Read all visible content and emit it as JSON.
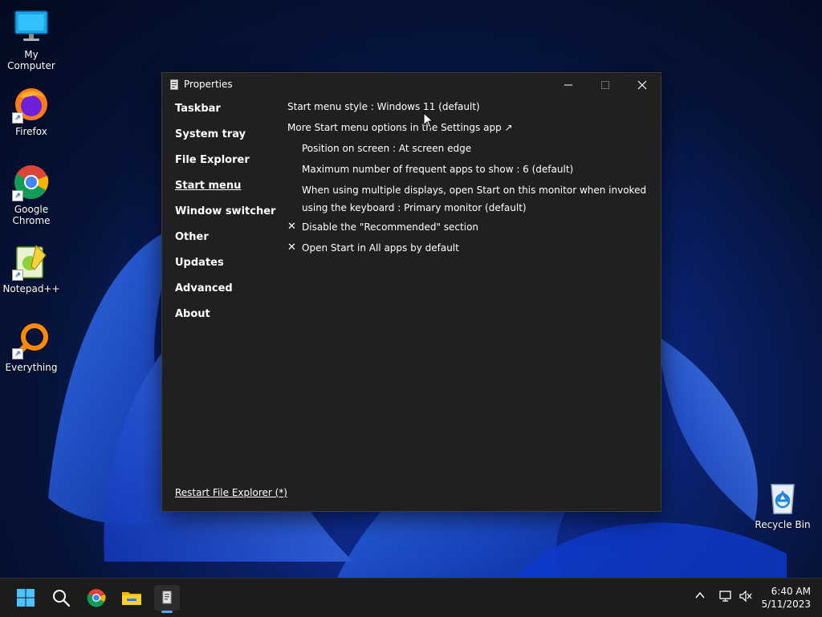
{
  "desktop_icons": [
    {
      "label": "My Computer"
    },
    {
      "label": "Firefox"
    },
    {
      "label": "Google Chrome"
    },
    {
      "label": "Notepad++"
    },
    {
      "label": "Everything"
    },
    {
      "label": "Recycle Bin"
    }
  ],
  "window": {
    "title": "Properties",
    "nav": [
      "Taskbar",
      "System tray",
      "File Explorer",
      "Start menu",
      "Window switcher",
      "Other",
      "Updates",
      "Advanced",
      "About"
    ],
    "active_nav": "Start menu",
    "settings": {
      "start_menu_style": "Start menu style : Windows 11 (default)",
      "more_options": "More Start menu options in the Settings app ↗",
      "position": "Position on screen : At screen edge",
      "max_frequent": "Maximum number of frequent apps to show : 6 (default)",
      "multi_display": "When using multiple displays, open Start on this monitor when invoked using the keyboard : Primary monitor (default)",
      "disable_recommended": "Disable the \"Recommended\" section",
      "open_all_apps": "Open Start in All apps by default"
    },
    "check_mark": "✕",
    "restart_link": "Restart File Explorer (*)"
  },
  "taskbar": {
    "time": "6:40 AM",
    "date": "5/11/2023"
  },
  "colors": {
    "window_bg": "#202020",
    "taskbar_bg": "#1c1c1c",
    "accent": "#5ea0ef"
  }
}
